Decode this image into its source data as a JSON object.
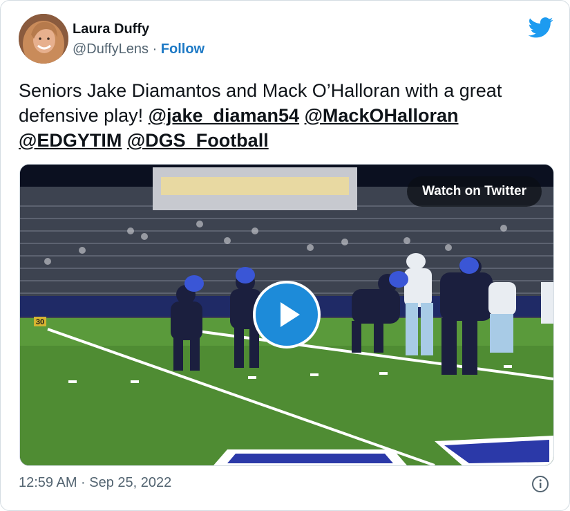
{
  "author": {
    "name": "Laura Duffy",
    "handle": "@DuffyLens",
    "separator": "·",
    "follow_label": "Follow"
  },
  "tweet": {
    "text_intro": "Seniors Jake Diamantos and Mack O’Halloran with a great defensive play! ",
    "mentions": [
      "@jake_diaman54",
      "@MackOHalloran",
      "@EDGYTIM",
      "@DGS_Football"
    ]
  },
  "media": {
    "watch_label": "Watch on Twitter",
    "yard_marker": "30"
  },
  "footer": {
    "timestamp": "12:59 AM · Sep 25, 2022"
  },
  "colors": {
    "accent": "#1d9bf0",
    "follow": "#1d79c5",
    "field": "#4f8c33",
    "jersey": "#2a2f5e"
  },
  "icons": {
    "brand": "twitter-bird-icon",
    "play": "play-icon",
    "info": "info-icon"
  }
}
